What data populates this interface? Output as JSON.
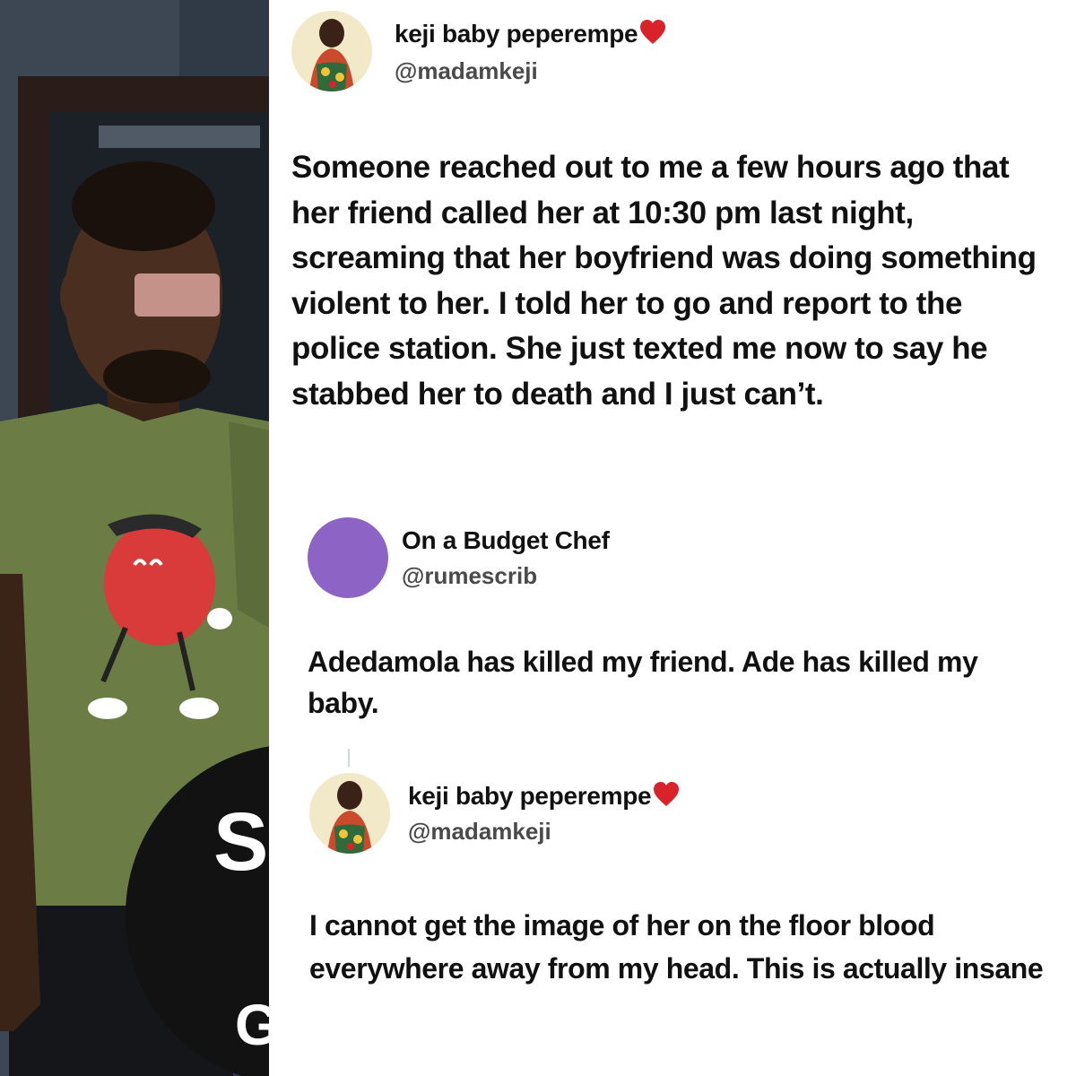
{
  "tweets": [
    {
      "display_name": "keji baby peperempe",
      "handle": "@madamkeji",
      "avatar": "woman-in-colorful-dress-avatar",
      "name_emoji": "heart-icon",
      "text": "Someone reached out to me a few hours ago that her friend called her at 10:30 pm last night, screaming that her boyfriend was doing something violent to her. I told her to go and report to the police station. She just texted me now to say he stabbed her to death and I just can’t."
    },
    {
      "display_name": "On a Budget Chef",
      "handle": "@rumescrib",
      "avatar": "purple-circle-avatar",
      "text": "Adedamola has killed my friend. Ade has killed my baby."
    },
    {
      "display_name": "keji baby peperempe",
      "handle": "@madamkeji",
      "avatar": "woman-in-colorful-dress-avatar",
      "name_emoji": "heart-icon",
      "text": "I cannot get the image of her on the floor blood everywhere away from my head. This is actually insane"
    }
  ],
  "photo": {
    "overlay_letters": [
      "S",
      "G"
    ],
    "colors": {
      "shirt": "#6b7d45",
      "apple": "#d93a3a",
      "wall": "#3b4653",
      "door": "#2a1c18"
    }
  },
  "colors": {
    "heart": "#d8232a",
    "avatar_purple": "#8e63c6",
    "text": "#111111",
    "handle": "#4a4a4a"
  }
}
